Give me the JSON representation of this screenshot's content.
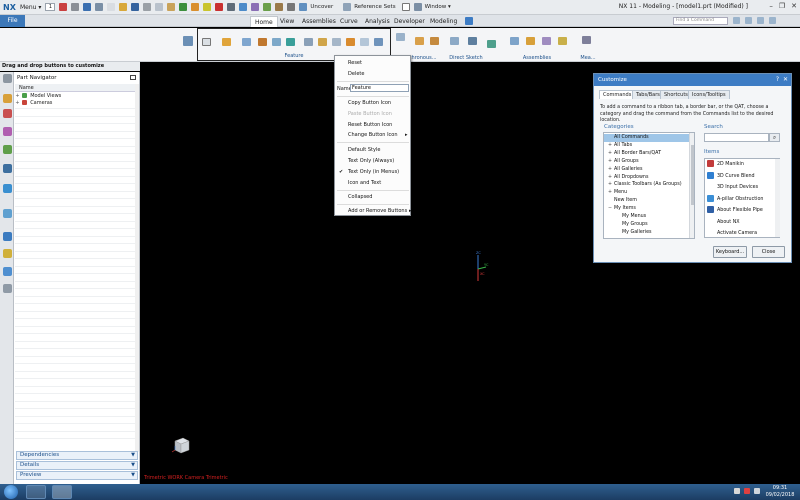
{
  "titlebar": {
    "logo": "NX",
    "menu_label": "Menu ▾",
    "selection_box": "1",
    "uncover_label": "Uncover",
    "reference_sets_label": "Reference Sets",
    "window_label": "Window ▾",
    "window_title": "NX 11 - Modeling - [model1.prt (Modified) ]",
    "min_glyph": "–",
    "max_glyph": "❐",
    "close_glyph": "✕"
  },
  "ribbon_tabs": {
    "file": "File",
    "tabs": [
      "Home",
      "View",
      "Assemblies",
      "Curve",
      "Analysis",
      "Developer",
      "Modeling"
    ],
    "active": "Home",
    "find_placeholder": "Find a Command"
  },
  "ribbon": {
    "groups": [
      {
        "label": "Feature"
      },
      {
        "label": "Synchronous..."
      },
      {
        "label": "Direct Sketch"
      },
      {
        "label": "Assemblies"
      },
      {
        "label": "Mea..."
      }
    ]
  },
  "cue_hint": "Drag and drop buttons to customize",
  "part_navigator": {
    "title": "Part Navigator",
    "column_header": "Name",
    "rows": [
      {
        "expand": "+",
        "label": "Model Views"
      },
      {
        "expand": "+",
        "label": "Cameras"
      }
    ],
    "sections": [
      "Dependencies",
      "Details",
      "Preview"
    ]
  },
  "graphics": {
    "view_status": "Trimetric WORK Camera Trimetric",
    "triad_labels": {
      "z": "ZC",
      "y": "YC",
      "x": "XC"
    }
  },
  "context_menu": {
    "reset": "Reset",
    "delete": "Delete",
    "name_label": "Name",
    "name_value": "Feature",
    "copy_icon": "Copy Button Icon",
    "paste_icon": "Paste Button Icon",
    "reset_icon": "Reset Button Icon",
    "change_icon": "Change Button Icon",
    "default_style": "Default Style",
    "text_only_always": "Text Only (Always)",
    "text_only_menus": "Text Only (in Menus)",
    "icon_and_text": "Icon and Text",
    "collapsed": "Collapsed",
    "add_remove": "Add or Remove Buttons",
    "checkmark": "✔"
  },
  "dialog": {
    "title": "Customize",
    "help_glyph": "?",
    "close_glyph": "✕",
    "tabs": [
      "Commands",
      "Tabs/Bars",
      "Shortcuts",
      "Icons/Tooltips"
    ],
    "active_tab": "Commands",
    "description": "To add a command to a ribbon tab, a border bar, or the QAT, choose a category and drag the command from the Commands list to the desired location.",
    "categories_label": "Categories",
    "search_label": "Search",
    "items_label": "Items",
    "categories": [
      {
        "expand": "",
        "label": "All Commands",
        "selected": true
      },
      {
        "expand": "+",
        "label": "All Tabs"
      },
      {
        "expand": "+",
        "label": "All Border Bars/QAT"
      },
      {
        "expand": "+",
        "label": "All Groups"
      },
      {
        "expand": "+",
        "label": "All Galleries"
      },
      {
        "expand": "+",
        "label": "All Dropdowns"
      },
      {
        "expand": "+",
        "label": "Classic Toolbars (As Groups)"
      },
      {
        "expand": "+",
        "label": "Menu"
      },
      {
        "expand": "",
        "label": "New Item"
      },
      {
        "expand": "−",
        "label": "My Items"
      },
      {
        "expand": "",
        "label": "My Menus",
        "indent": true
      },
      {
        "expand": "",
        "label": "My Groups",
        "indent": true
      },
      {
        "expand": "",
        "label": "My Galleries",
        "indent": true
      }
    ],
    "items": [
      {
        "label": "2D Manikin",
        "color": "#c23b3b"
      },
      {
        "label": "3D Curve Blend",
        "color": "#2f7fd1"
      },
      {
        "label": "3D Input Devices",
        "color": ""
      },
      {
        "label": "A-pillar Obstruction",
        "color": "#3b8fd6"
      },
      {
        "label": "About Flexible Pipe",
        "color": "#2f5fa5"
      },
      {
        "label": "About NX",
        "color": ""
      },
      {
        "label": "Activate Camera",
        "color": ""
      }
    ],
    "keyboard_button": "Keyboard...",
    "close_button": "Close",
    "search_glyph": "⌕"
  },
  "taskbar": {
    "time": "09:31",
    "date": "09/02/2018"
  }
}
